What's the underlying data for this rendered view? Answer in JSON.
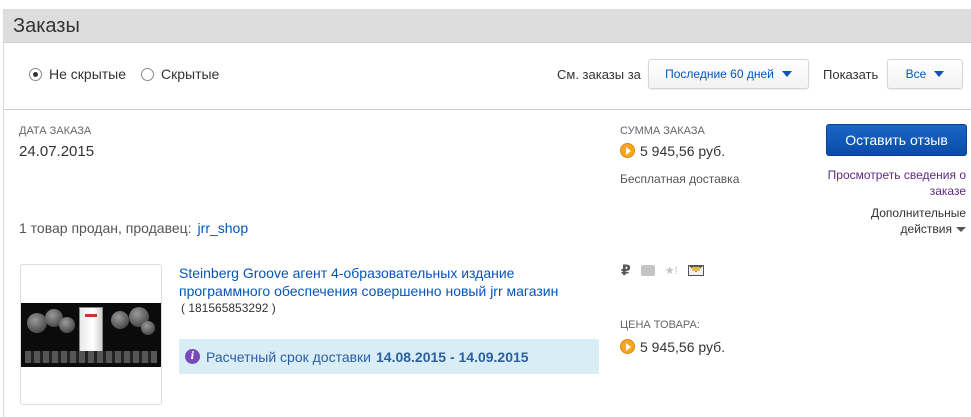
{
  "header": {
    "title": "Заказы"
  },
  "filters": {
    "visible_label": "Не скрытые",
    "hidden_label": "Скрытые",
    "selected": "visible",
    "period_label": "См. заказы за",
    "period_value": "Последние 60 дней",
    "show_label": "Показать",
    "show_value": "Все"
  },
  "order": {
    "date_label": "ДАТА ЗАКАЗА",
    "date": "24.07.2015",
    "sum_label": "СУММА ЗАКАЗА",
    "sum": "5 945,56 руб.",
    "shipping": "Бесплатная доставка",
    "review_button": "Оставить отзыв",
    "details_link": "Просмотреть сведения о заказе",
    "more_actions": "Дополнительные действия",
    "seller_text": "1 товар продан, продавец:",
    "seller_name": "jrr_shop"
  },
  "item": {
    "title": "Steinberg Groove агент 4-образовательных издание программного обеспечения совершенно новый jrr магазин",
    "id": "( 181565853292 )",
    "delivery_label": "Расчетный срок доставки",
    "delivery_dates": "14.08.2015 - 14.09.2015",
    "price_label": "ЦЕНА ТОВАРА:",
    "price": "5 945,56 руб.",
    "status_currency": "₽"
  },
  "colors": {
    "link": "#0654ba",
    "visited_link": "#5e2a84",
    "primary_button": "#0a4ca6",
    "delivery_bg": "#d9edf7",
    "coin": "#f5a623"
  },
  "icons": [
    "radio-checked-icon",
    "radio-unchecked-icon",
    "caret-down-icon",
    "coin-icon",
    "ruble-icon",
    "card-icon",
    "star-icon",
    "envelope-icon",
    "info-icon"
  ]
}
